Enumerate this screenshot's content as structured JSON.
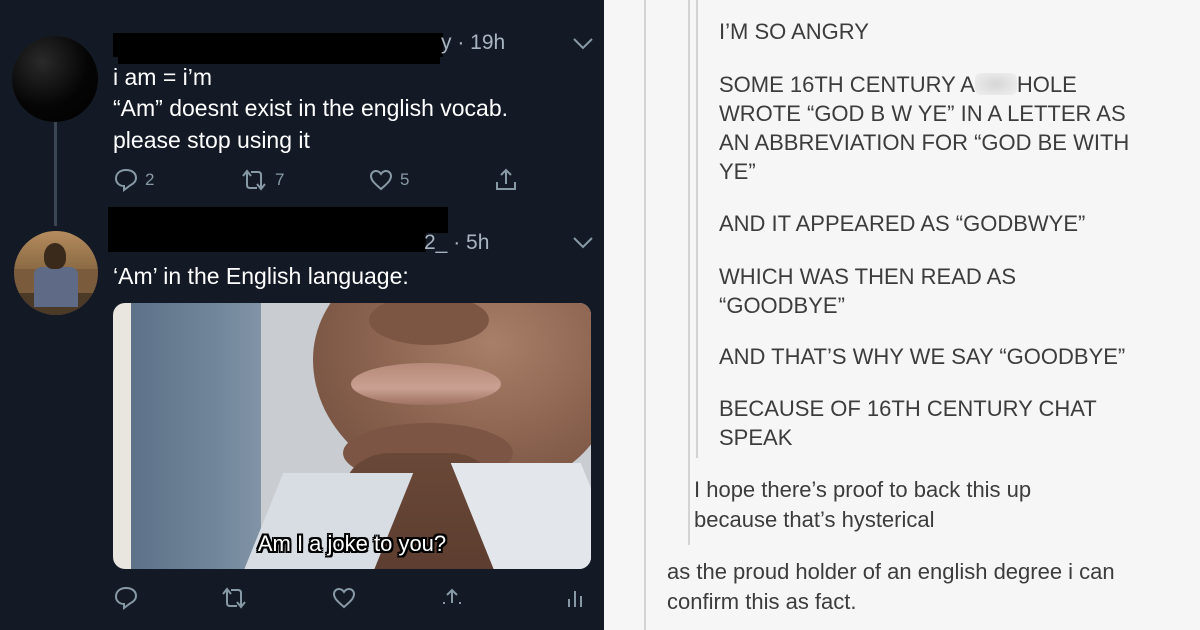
{
  "twitter": {
    "tweet1": {
      "handle_tail": "y · 19h",
      "lines": [
        "i am = i’m",
        "“Am” doesnt exist in the english vocab.",
        "please stop using it"
      ],
      "replies": "2",
      "retweets": "7",
      "likes": "5"
    },
    "tweet2": {
      "handle_tail": "2_ · 5h",
      "text": "‘Am’ in the English language:",
      "meme_caption": "Am I a joke to you?"
    },
    "icons": [
      "reply-icon",
      "retweet-icon",
      "like-icon",
      "share-icon",
      "analytics-icon",
      "chevron-down-icon"
    ]
  },
  "tumblr": {
    "post": {
      "line_angry": "I’M SO ANGRY",
      "p1_line1_before": "SOME 16TH CENTURY A",
      "p1_line1_after": "HOLE",
      "p1_line2": "WROTE “GOD B W YE” IN A LETTER AS",
      "p1_line3": "AN ABBREVIATION FOR “GOD BE WITH",
      "p1_line4": "YE”",
      "p2": "AND IT APPEARED AS “GODBWYE”",
      "p3_line1": "WHICH WAS THEN READ AS",
      "p3_line2": "“GOODBYE”",
      "p4": "AND THAT’S WHY WE SAY “GOODBYE”",
      "p5_line1": "BECAUSE OF 16TH CENTURY CHAT",
      "p5_line2": "SPEAK"
    },
    "reply1": {
      "line1": "I hope there’s proof to back this up",
      "line2": "because that’s hysterical"
    },
    "reply2": {
      "line1": "as the proud holder of an english degree i can",
      "line2": "confirm this as fact."
    }
  }
}
